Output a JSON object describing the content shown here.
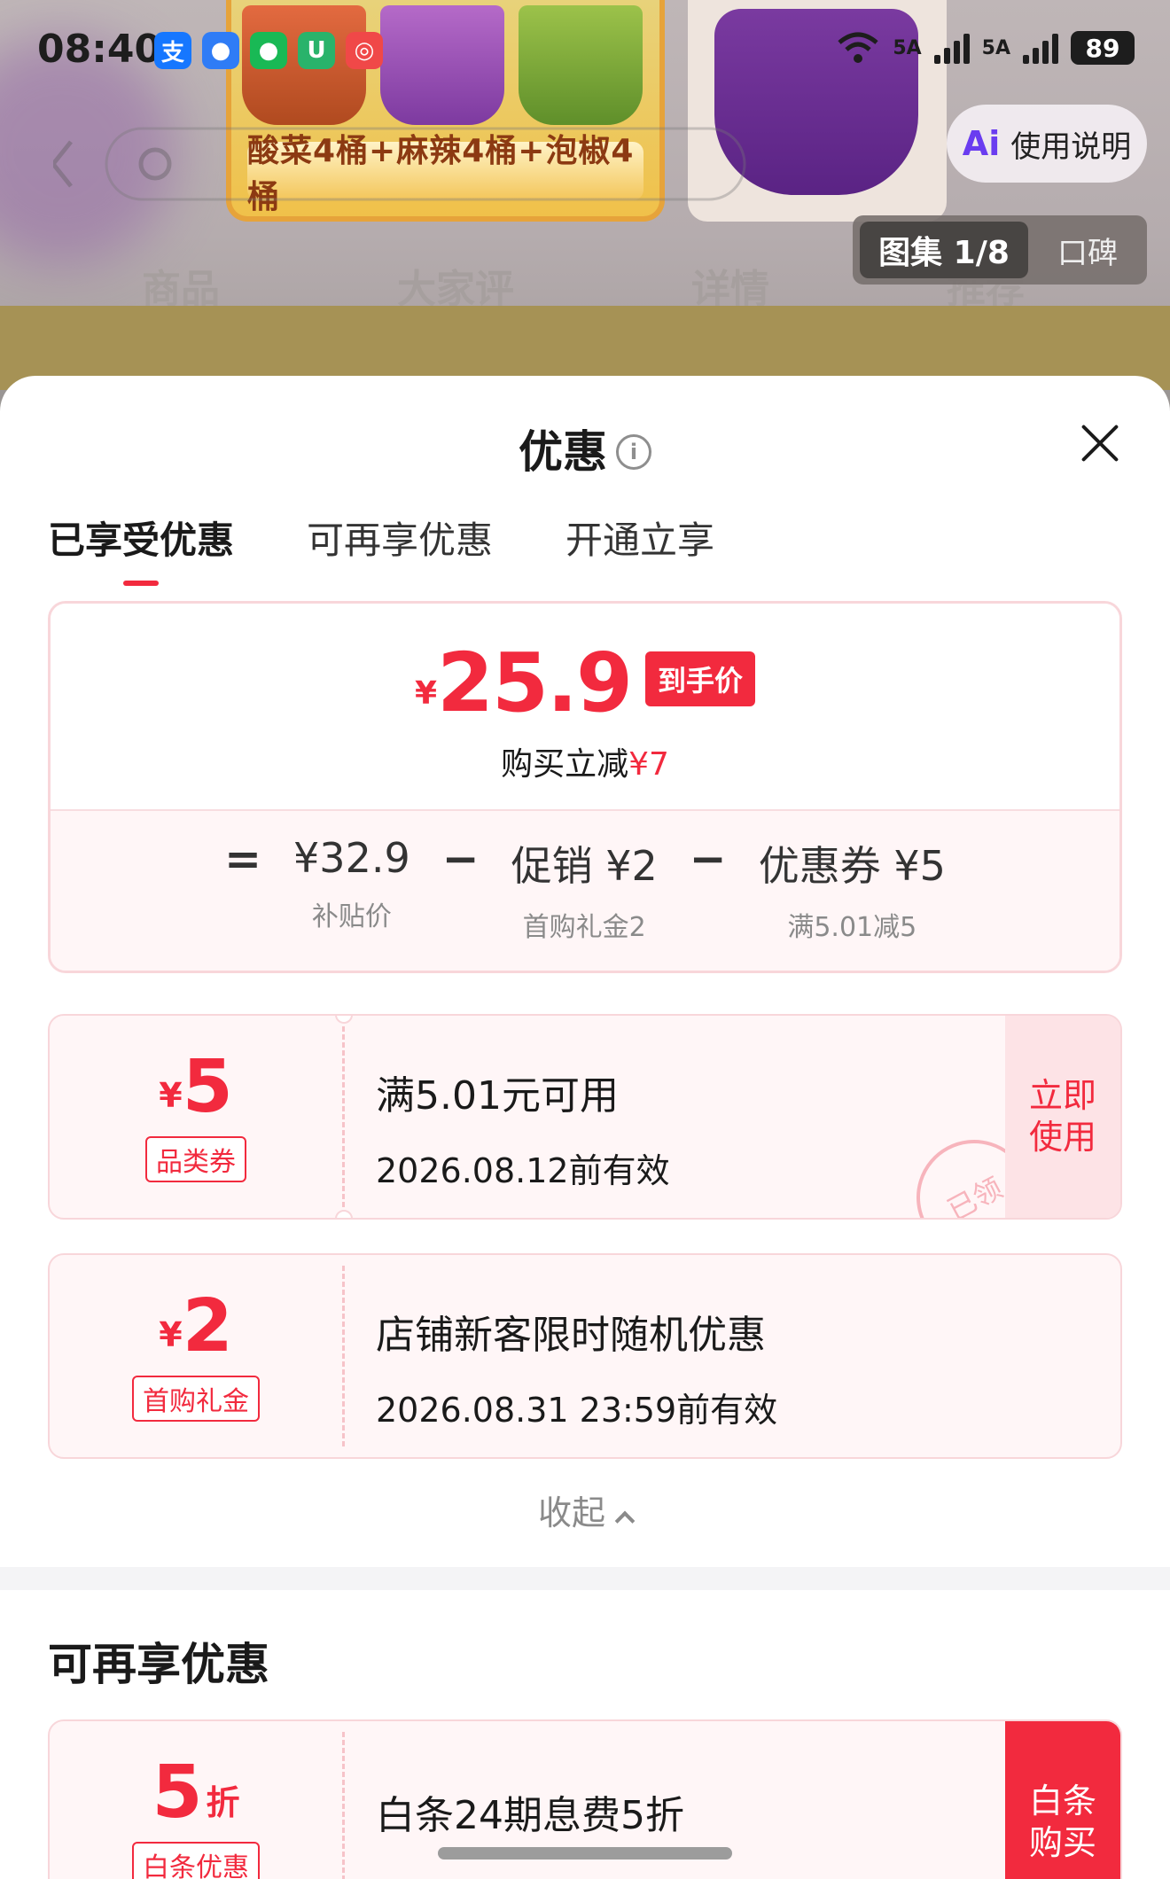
{
  "status_bar": {
    "time": "08:40",
    "signal_1": "5A",
    "signal_2": "5A",
    "battery": "89"
  },
  "background": {
    "promo_banner": "酸菜4桶+麻辣4桶+泡椒4桶",
    "ai_guide_label": "使用说明",
    "gallery_label": "图集 1/8",
    "reviews_label": "口碑",
    "tabs": [
      "商品",
      "大家评",
      "详情",
      "推荐"
    ]
  },
  "sheet": {
    "title": "优惠",
    "tabs": [
      {
        "label": "已享受优惠",
        "active": true
      },
      {
        "label": "可再享优惠",
        "active": false
      },
      {
        "label": "开通立享",
        "active": false
      }
    ]
  },
  "price_card": {
    "yen": "¥",
    "final_price": "25.9",
    "final_badge": "到手价",
    "saving_prefix": "购买立减",
    "saving_amount": "¥7",
    "equals": "=",
    "minus": "−",
    "subsidy_price": "¥32.9",
    "subsidy_label": "补贴价",
    "promo_value": "促销 ¥2",
    "promo_label": "首购礼金2",
    "coupon_value": "优惠券 ¥5",
    "coupon_label": "满5.01减5"
  },
  "coupons": [
    {
      "yen": "¥",
      "amount": "5",
      "tag": "品类券",
      "title": "满5.01元可用",
      "date": "2026.08.12前有效",
      "cta": "立即使用",
      "stamp": "已领"
    },
    {
      "yen": "¥",
      "amount": "2",
      "tag": "首购礼金",
      "title": "店铺新客限时随机优惠",
      "date": "2026.08.31 23:59前有效"
    }
  ],
  "collapse_label": "收起",
  "more_section": {
    "title": "可再享优惠",
    "card": {
      "amount": "5",
      "unit": "折",
      "tag": "白条优惠",
      "title": "白条24期息费5折",
      "cta": "白条购买"
    }
  },
  "colors": {
    "accent_red": "#f22a3e",
    "card_tint": "#fff6f7"
  }
}
